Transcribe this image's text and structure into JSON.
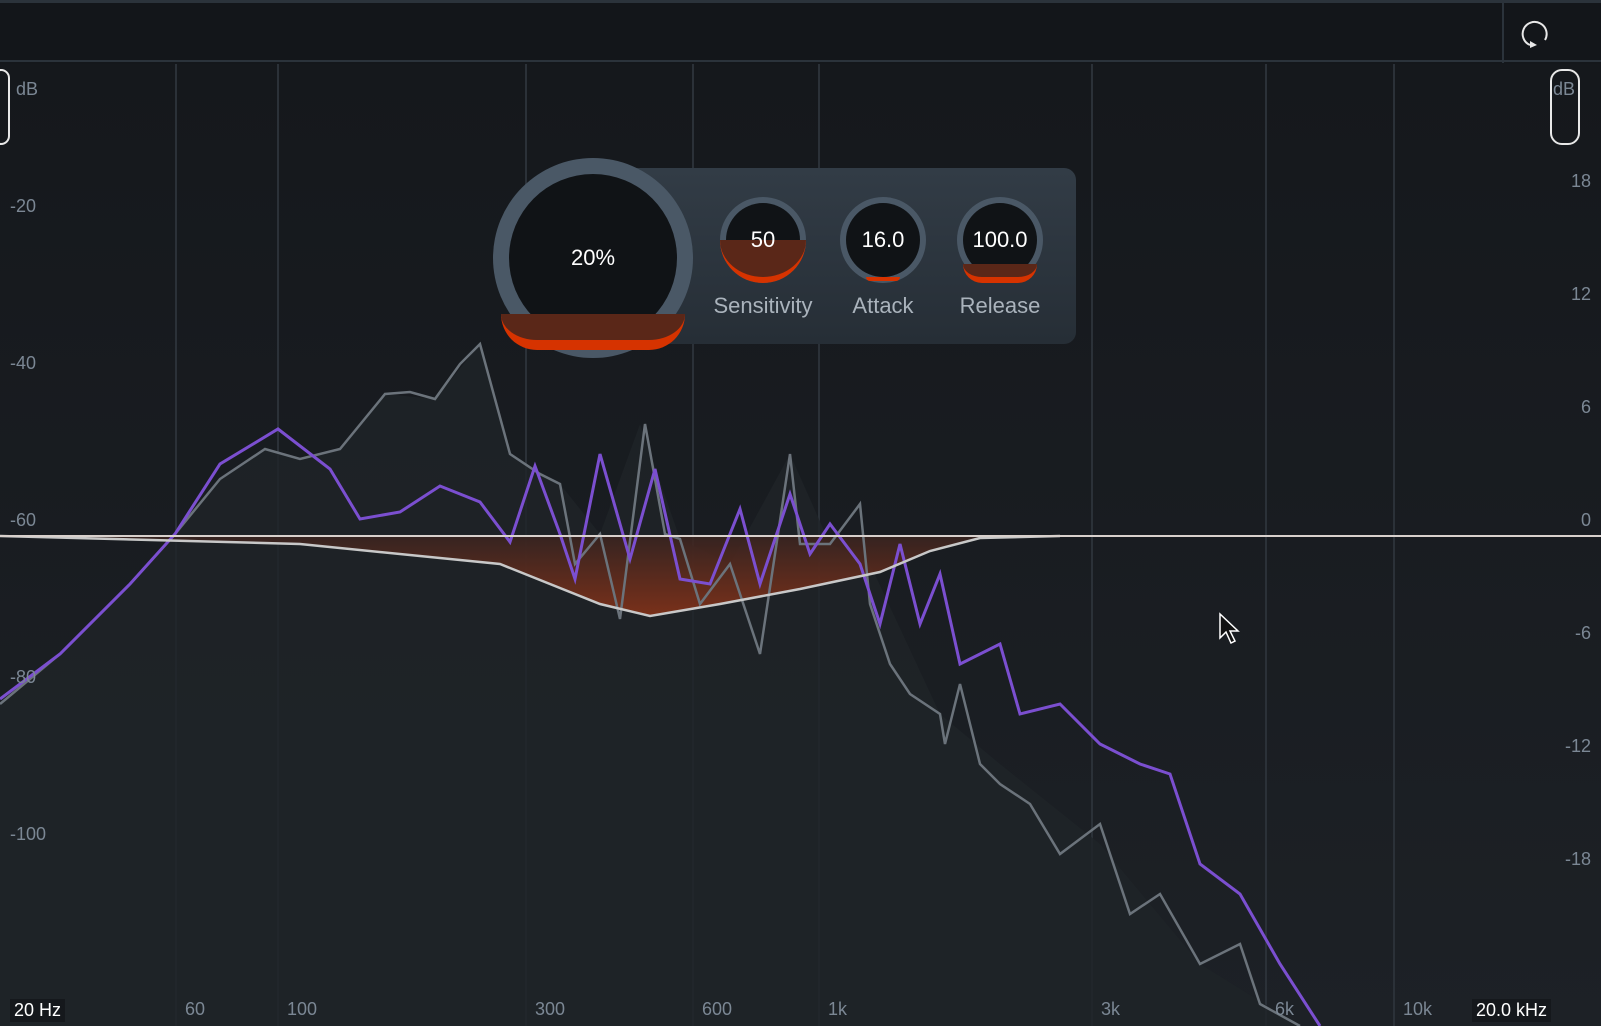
{
  "toolbar": {
    "reset_icon": "rotate-reset-icon"
  },
  "axes": {
    "left_unit": "dB",
    "right_unit": "dB",
    "left_ticks": [
      "-20",
      "-40",
      "-60",
      "-80",
      "-100"
    ],
    "right_ticks": [
      "18",
      "12",
      "6",
      "0",
      "-6",
      "-12",
      "-18"
    ],
    "freq_ticks": [
      "60",
      "100",
      "300",
      "600",
      "1k",
      "3k",
      "6k",
      "10k"
    ],
    "freq_min": "20 Hz",
    "freq_max": "20.0 kHz"
  },
  "controls": {
    "amount": {
      "value": "20%",
      "fill": 0.2
    },
    "sensitivity": {
      "label": "Sensitivity",
      "value": "50",
      "fill": 0.5
    },
    "attack": {
      "label": "Attack",
      "value": "16.0",
      "fill": 0.04
    },
    "release": {
      "label": "Release",
      "value": "100.0",
      "fill": 0.22
    }
  },
  "colors": {
    "accent": "#d63300",
    "input": "#7b4fd0",
    "output": "#6b737b"
  }
}
